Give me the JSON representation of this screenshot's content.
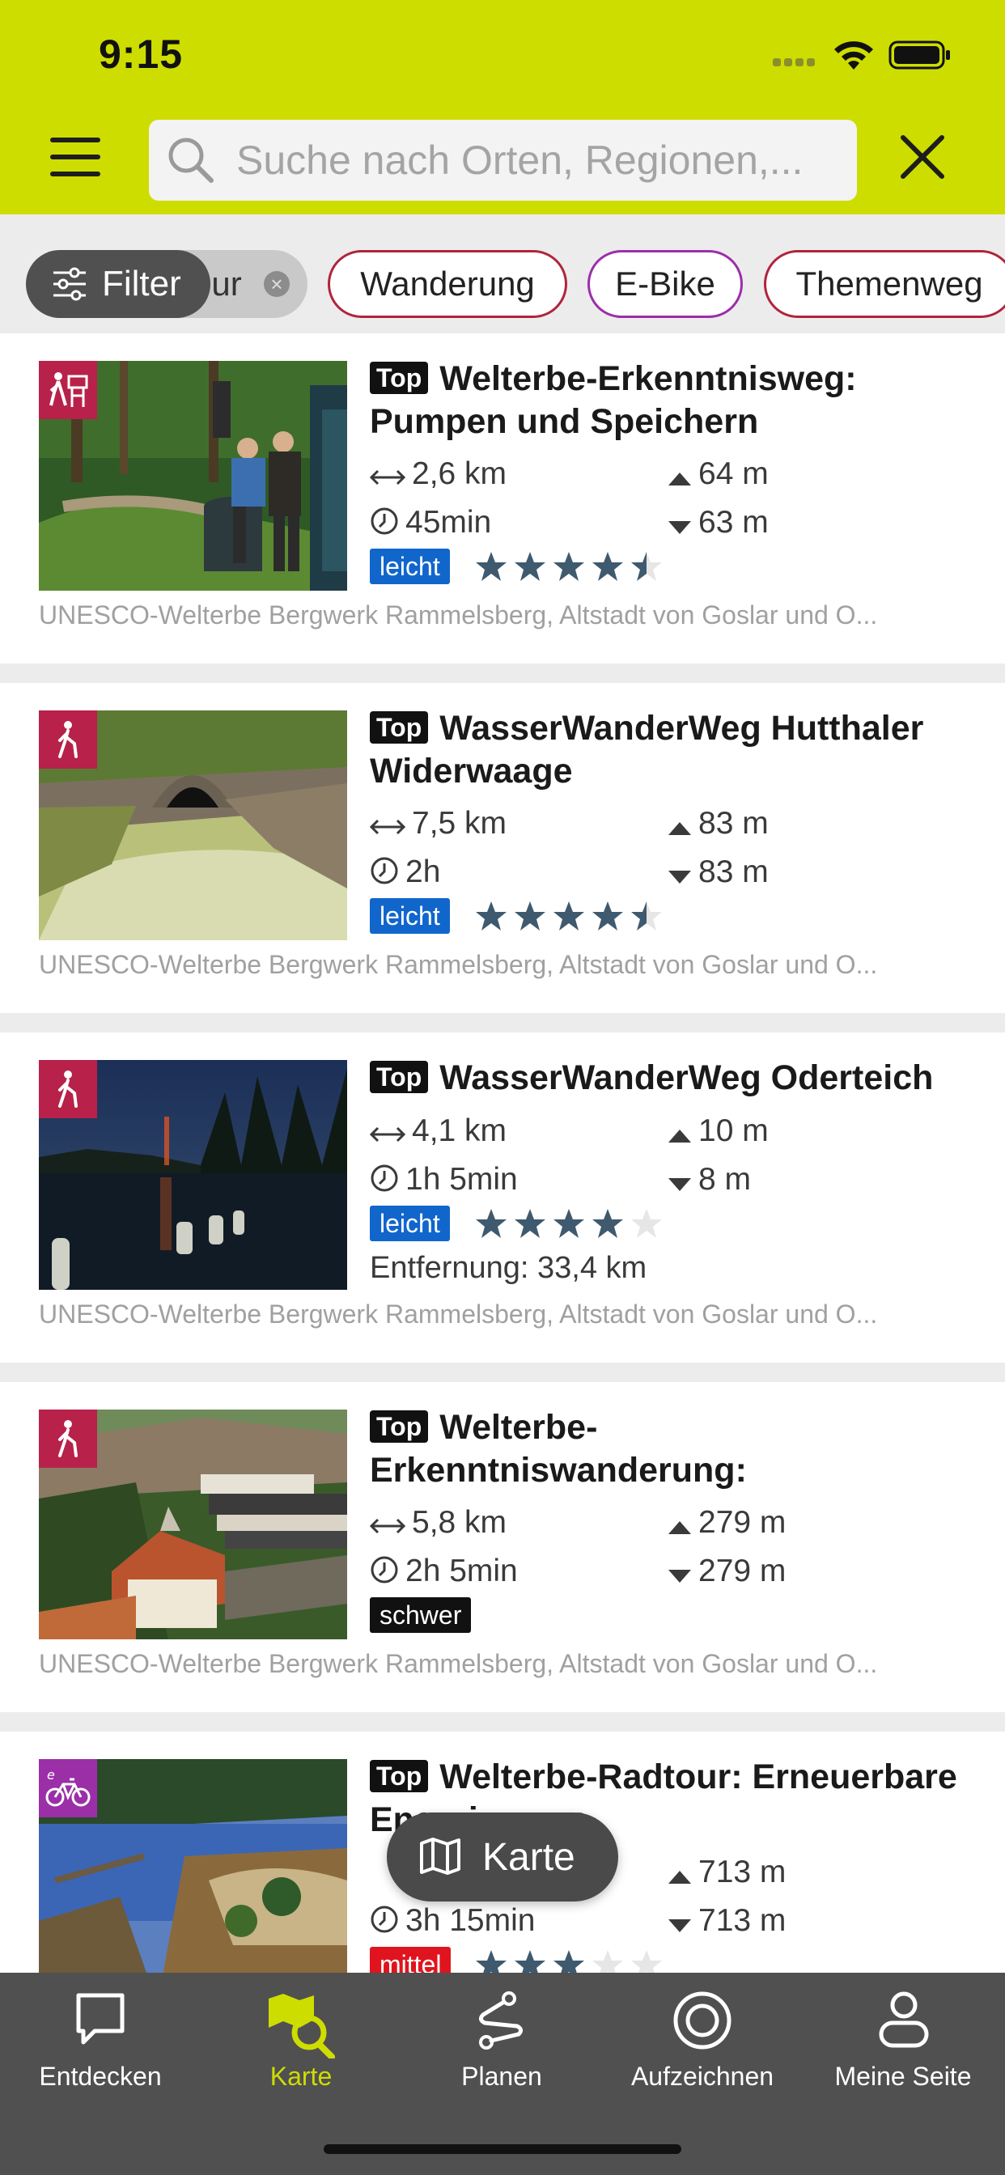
{
  "status_bar": {
    "time": "9:15"
  },
  "search": {
    "placeholder": "Suche nach Orten, Regionen,..."
  },
  "filters": {
    "filter_label": "Filter",
    "hidden_chip_label": "our",
    "chips": [
      "Wanderung",
      "E-Bike",
      "Themenweg"
    ]
  },
  "tours": [
    {
      "top_label": "Top",
      "category_icon": "theme-trail-icon",
      "title": "Welterbe-Erkenntnisweg: Pumpen und Speichern",
      "distance": "2,6 km",
      "duration": "45min",
      "ascent": "64 m",
      "descent": "63 m",
      "difficulty": "leicht",
      "rating": 4.5,
      "region": "UNESCO-Welterbe Bergwerk Rammelsberg, Altstadt von Goslar und O..."
    },
    {
      "top_label": "Top",
      "category_icon": "hiking-icon",
      "title": "WasserWanderWeg Hutthaler Widerwaage",
      "distance": "7,5 km",
      "duration": "2h",
      "ascent": "83 m",
      "descent": "83 m",
      "difficulty": "leicht",
      "rating": 4.5,
      "region": "UNESCO-Welterbe Bergwerk Rammelsberg, Altstadt von Goslar und O..."
    },
    {
      "top_label": "Top",
      "category_icon": "hiking-icon",
      "title": "WasserWanderWeg Oderteich",
      "distance": "4,1 km",
      "duration": "1h 5min",
      "ascent": "10 m",
      "descent": "8 m",
      "difficulty": "leicht",
      "rating": 4,
      "distance_away": "Entfernung: 33,4 km",
      "region": "UNESCO-Welterbe Bergwerk Rammelsberg, Altstadt von Goslar und O..."
    },
    {
      "top_label": "Top",
      "category_icon": "hiking-icon",
      "title": "Welterbe-Erkenntniswanderung:",
      "distance": "5,8 km",
      "duration": "2h 5min",
      "ascent": "279 m",
      "descent": "279 m",
      "difficulty": "schwer",
      "region": "UNESCO-Welterbe Bergwerk Rammelsberg, Altstadt von Goslar und O..."
    },
    {
      "top_label": "Top",
      "category_icon": "ebike-icon",
      "title": "Welterbe-Radtour: Erneuerbare Energien aus",
      "distance": "",
      "duration": "3h 15min",
      "ascent": "713 m",
      "descent": "713 m",
      "difficulty": "mittel",
      "rating": 3
    }
  ],
  "map_button": {
    "label": "Karte"
  },
  "bottom_nav": [
    {
      "label": "Entdecken",
      "icon": "discover-icon"
    },
    {
      "label": "Karte",
      "icon": "map-search-icon",
      "active": true
    },
    {
      "label": "Planen",
      "icon": "route-plan-icon"
    },
    {
      "label": "Aufzeichnen",
      "icon": "record-icon"
    },
    {
      "label": "Meine Seite",
      "icon": "profile-icon"
    }
  ],
  "colors": {
    "brand": "#cedd00",
    "chip_border": "#b0243c",
    "difficulty_easy": "#1166cc",
    "difficulty_medium": "#e0141e",
    "difficulty_hard": "#111111",
    "star": "#3f5a6e",
    "nav_background": "#505050"
  }
}
